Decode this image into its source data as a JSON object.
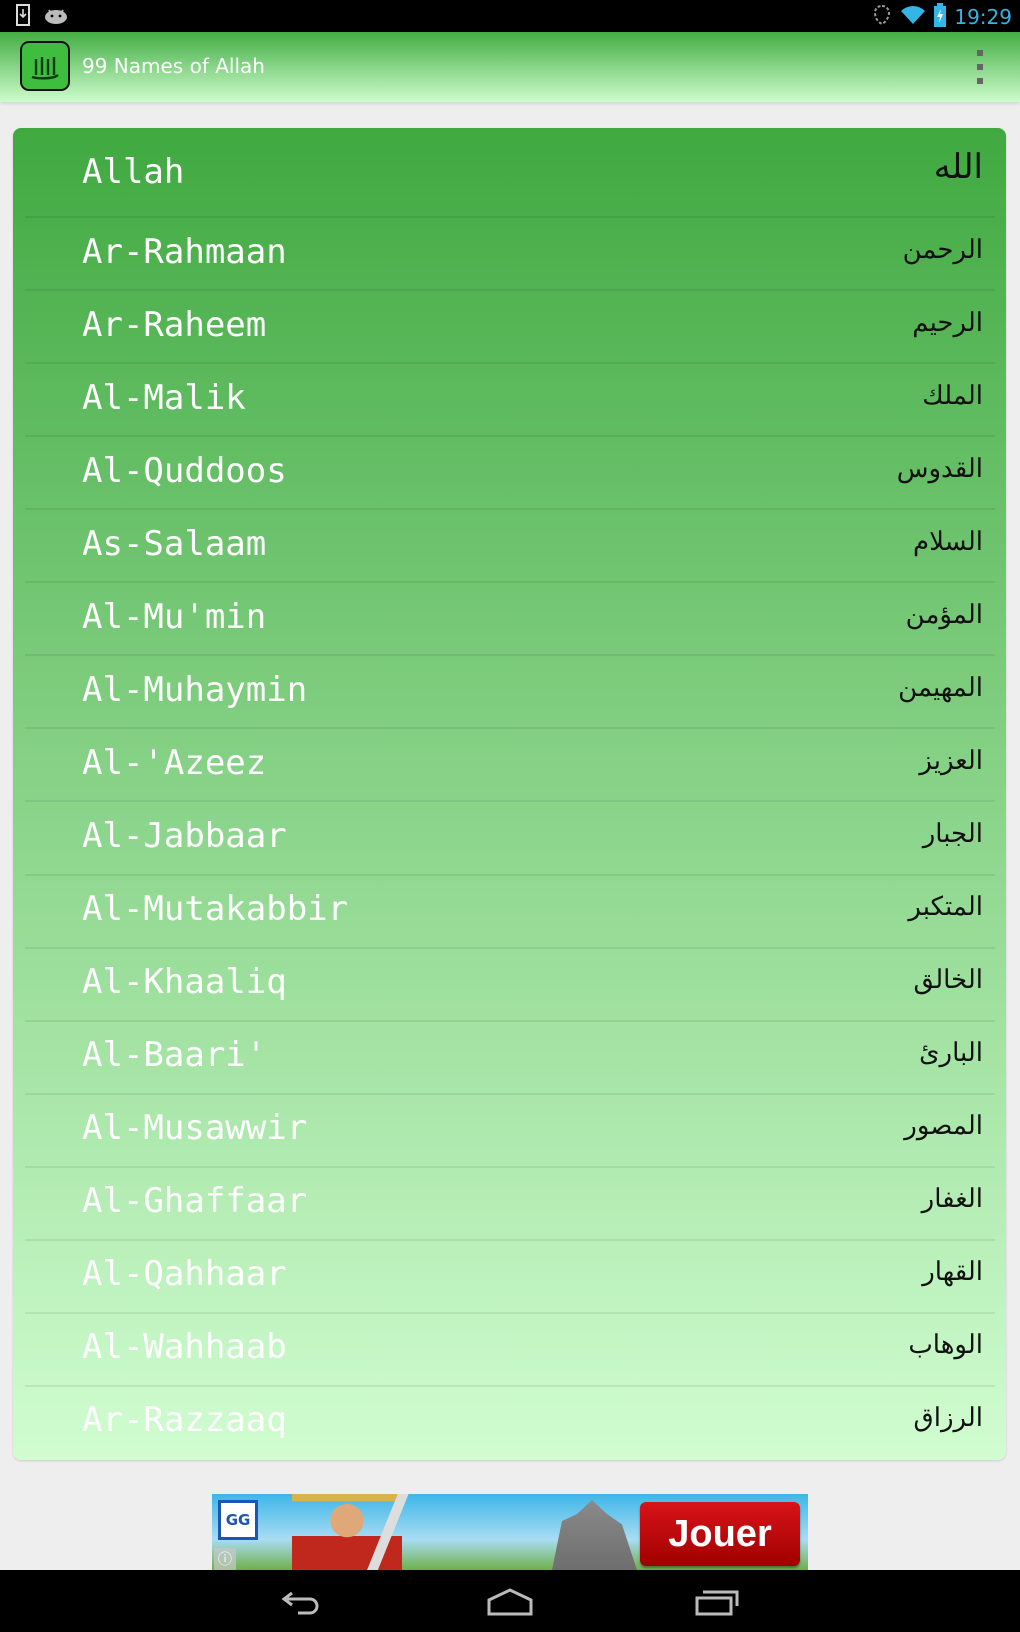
{
  "status_bar": {
    "time": "19:29",
    "icons": [
      "download-notification-icon",
      "android-notification-icon",
      "sync-icon",
      "wifi-icon",
      "battery-charging-icon"
    ]
  },
  "action_bar": {
    "app_icon": "allah-calligraphy-icon",
    "title": "99 Names of Allah",
    "overflow_icon": "overflow-menu-icon"
  },
  "names": [
    {
      "latin": "Allah",
      "arabic": "الله"
    },
    {
      "latin": "Ar-Rahmaan",
      "arabic": "الرحمن"
    },
    {
      "latin": "Ar-Raheem",
      "arabic": "الرحيم"
    },
    {
      "latin": "Al-Malik",
      "arabic": "الملك"
    },
    {
      "latin": "Al-Quddoos",
      "arabic": "القدوس"
    },
    {
      "latin": "As-Salaam",
      "arabic": "السلام"
    },
    {
      "latin": "Al-Mu'min",
      "arabic": "المؤمن"
    },
    {
      "latin": "Al-Muhaymin",
      "arabic": "المهيمن"
    },
    {
      "latin": "Al-'Azeez",
      "arabic": "العزيز"
    },
    {
      "latin": "Al-Jabbaar",
      "arabic": "الجبار"
    },
    {
      "latin": "Al-Mutakabbir",
      "arabic": "المتكبر"
    },
    {
      "latin": "Al-Khaaliq",
      "arabic": "الخالق"
    },
    {
      "latin": "Al-Baari'",
      "arabic": "البارئ"
    },
    {
      "latin": "Al-Musawwir",
      "arabic": "المصور"
    },
    {
      "latin": "Al-Ghaffaar",
      "arabic": "الغفار"
    },
    {
      "latin": "Al-Qahhaar",
      "arabic": "القهار"
    },
    {
      "latin": "Al-Wahhaab",
      "arabic": "الوهاب"
    },
    {
      "latin": "Ar-Razzaaq",
      "arabic": "الرزاق"
    }
  ],
  "ad": {
    "logo_text": "GG",
    "info_icon": "ⓘ",
    "cta_label": "Jouer"
  },
  "nav_bar": {
    "buttons": [
      "back-icon",
      "home-icon",
      "recent-apps-icon"
    ]
  },
  "colors": {
    "status_time": "#33b5e5",
    "card_top": "#40a940",
    "card_bottom": "#d1fdd1",
    "cta_red": "#c8101a"
  }
}
